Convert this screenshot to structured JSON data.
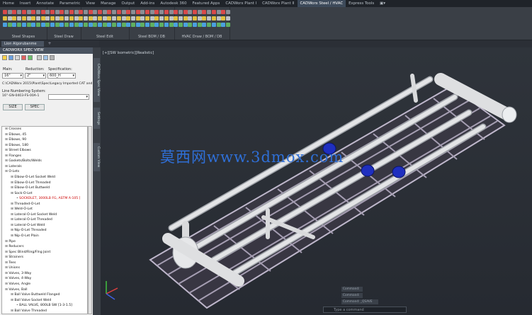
{
  "ribbon": {
    "tabs": [
      "Home",
      "Insert",
      "Annotate",
      "Parametric",
      "View",
      "Manage",
      "Output",
      "Add-ins",
      "Autodesk 360",
      "Featured Apps",
      "CADWorx Plant I",
      "CADWorx Plant II",
      "CADWorx Steel / HVAC",
      "Express Tools",
      "▣▾"
    ],
    "active_tab": "CADWorx Steel / HVAC",
    "panels": [
      "Steel Shapes",
      "Steel Draw",
      "Steel Edit",
      "Steel BOM / DB",
      "HVAC Draw / BOM / DB"
    ]
  },
  "doc_tabs": {
    "active": "Lion Algorubanme",
    "add": "+"
  },
  "palette": {
    "title": "CADWORX SPEC VIEW",
    "main_label": "Main:",
    "main_value": "16\"",
    "reduction_label": "Reduction:",
    "reduction_value": "2\"",
    "spec_label": "Specification:",
    "spec_value": "600_H",
    "path": "C:\\CADWorx 2015\\Plant\\Spec\\Legacy Imported CAT and",
    "line_label": "Line Numbering System:",
    "line_value": "16\"-GN-0403-FS-00A-1",
    "btn_size": "SIZE",
    "btn_spec": "SPEC",
    "tree": [
      {
        "text": "Crosses",
        "indent": 0,
        "red": false
      },
      {
        "text": "Elbows, 45",
        "indent": 0,
        "red": false
      },
      {
        "text": "Elbows, 90",
        "indent": 0,
        "red": false
      },
      {
        "text": "Elbows, 180",
        "indent": 0,
        "red": false
      },
      {
        "text": "Street Elbows",
        "indent": 0,
        "red": false
      },
      {
        "text": "Flanges",
        "indent": 0,
        "red": false
      },
      {
        "text": "Gaskets/Bolts/Welds",
        "indent": 0,
        "red": false
      },
      {
        "text": "Laterals",
        "indent": 0,
        "red": false
      },
      {
        "text": "O-Lets",
        "indent": 0,
        "red": false
      },
      {
        "text": "Elbow-O-Let Socket Weld",
        "indent": 1,
        "red": false
      },
      {
        "text": "Elbow-O-Let Threaded",
        "indent": 1,
        "red": false
      },
      {
        "text": "Elbow-O-Let Buttweld",
        "indent": 1,
        "red": false
      },
      {
        "text": "Sock-O-Let",
        "indent": 1,
        "red": false
      },
      {
        "text": "SOCKOLET, 3000LB FG, ASTM A-105 [",
        "indent": 2,
        "red": true
      },
      {
        "text": "Threaded-O-Let",
        "indent": 1,
        "red": false
      },
      {
        "text": "Weld-O-Let",
        "indent": 1,
        "red": false
      },
      {
        "text": "Lateral-O-Let Socket Weld",
        "indent": 1,
        "red": false
      },
      {
        "text": "Lateral-O-Let Threaded",
        "indent": 1,
        "red": false
      },
      {
        "text": "Lateral-O-Let Weld",
        "indent": 1,
        "red": false
      },
      {
        "text": "Nip-O-Let Threaded",
        "indent": 1,
        "red": false
      },
      {
        "text": "Nip-O-Let Plain",
        "indent": 1,
        "red": false
      },
      {
        "text": "Pipe",
        "indent": 0,
        "red": false
      },
      {
        "text": "Reducers",
        "indent": 0,
        "red": false
      },
      {
        "text": "Spec Blind/Ring/Flng Joint",
        "indent": 0,
        "red": false
      },
      {
        "text": "Strainers",
        "indent": 0,
        "red": false
      },
      {
        "text": "Tees",
        "indent": 0,
        "red": false
      },
      {
        "text": "Unions",
        "indent": 0,
        "red": false
      },
      {
        "text": "Valves, 3-Way",
        "indent": 0,
        "red": false
      },
      {
        "text": "Valves, 4-Way",
        "indent": 0,
        "red": false
      },
      {
        "text": "Valves, Angle",
        "indent": 0,
        "red": false
      },
      {
        "text": "Valves, Ball",
        "indent": 0,
        "red": false
      },
      {
        "text": "Ball Valve Buttweld Flanged",
        "indent": 1,
        "red": false
      },
      {
        "text": "Ball Valve Socket Weld",
        "indent": 1,
        "red": false
      },
      {
        "text": "BALL VALVE, 800LB SW [1-3-1.5]",
        "indent": 2,
        "red": false
      },
      {
        "text": "Ball Valve Threaded",
        "indent": 1,
        "red": false
      }
    ]
  },
  "side_tabs": [
    "CADWorx Spec View",
    "Settings",
    "Custom View"
  ],
  "viewport": {
    "label": "[+][SW Isometric][Realistic]",
    "watermark": "莫西网www.3dmox.com"
  },
  "command": {
    "history": [
      "Command:",
      "Command:",
      "Command: _QSAVE"
    ],
    "placeholder": "Type a command"
  },
  "colors": {
    "valve": "#1f2fbf",
    "pipe": "#d9dadc",
    "frame": "#a8a0b2"
  }
}
